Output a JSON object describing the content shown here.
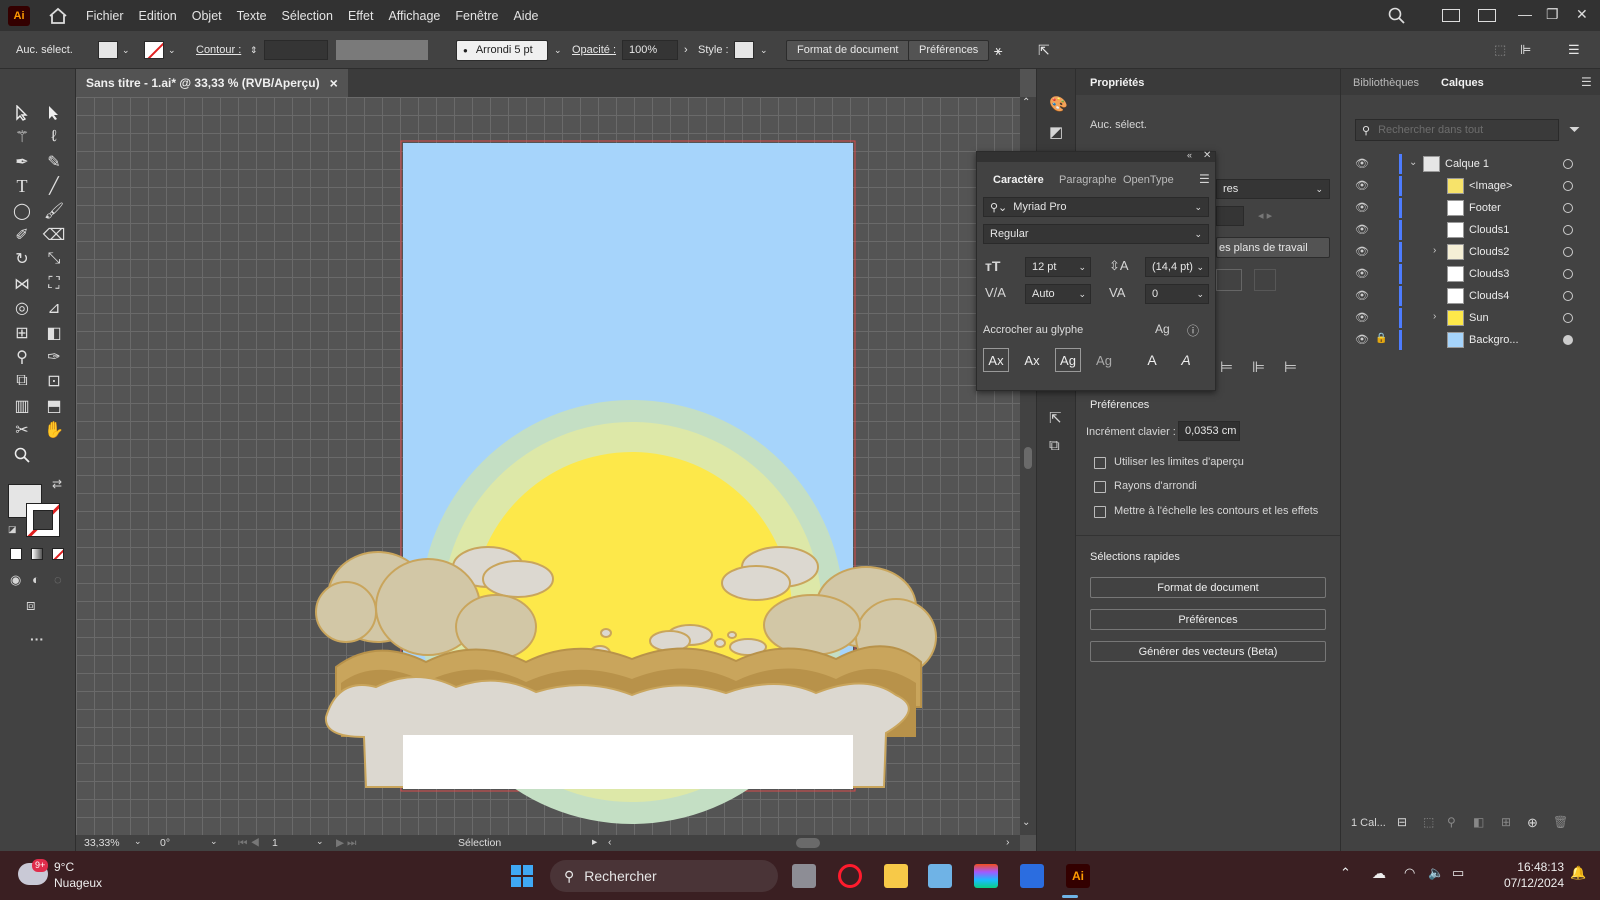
{
  "app": {
    "logo": "Ai"
  },
  "menu": [
    "Fichier",
    "Edition",
    "Objet",
    "Texte",
    "Sélection",
    "Effet",
    "Affichage",
    "Fenêtre",
    "Aide"
  ],
  "control": {
    "selection": "Auc. sélect.",
    "contour_label": "Contour :",
    "brush": "Arrondi 5 pt",
    "opacity_label": "Opacité :",
    "opacity": "100%",
    "style_label": "Style :",
    "doc_format": "Format de document",
    "preferences": "Préférences"
  },
  "document": {
    "tab_title": "Sans titre - 1.ai* @ 33,33 % (RVB/Aperçu)",
    "close": "×"
  },
  "status": {
    "zoom": "33,33%",
    "rotation": "0°",
    "artboard": "1",
    "tool": "Sélection"
  },
  "properties": {
    "tab": "Propriétés",
    "no_selection": "Auc. sélect.",
    "partial_dropdown": "res",
    "partial_artboards": "es plans de travail",
    "prefs_title": "Préférences",
    "key_increment_label": "Incrément clavier :",
    "key_increment": "0,0353 cm",
    "checkboxes": [
      "Utiliser les limites d'aperçu",
      "Rayons d'arrondi",
      "Mettre à l'échelle les contours et les effets"
    ],
    "quick_title": "Sélections rapides",
    "buttons": [
      "Format de document",
      "Préférences",
      "Générer des vecteurs (Beta)"
    ]
  },
  "character": {
    "tabs": [
      "Caractère",
      "Paragraphe",
      "OpenType"
    ],
    "font": "Myriad Pro",
    "style": "Regular",
    "size": "12 pt",
    "leading": "(14,4 pt)",
    "kerning": "Auto",
    "tracking": "0",
    "snap_label": "Accrocher au glyphe"
  },
  "layers": {
    "tabs": [
      "Bibliothèques",
      "Calques"
    ],
    "search_placeholder": "Rechercher dans tout",
    "items": [
      {
        "name": "Calque 1",
        "level": 0,
        "expanded": true
      },
      {
        "name": "<Image>",
        "level": 1
      },
      {
        "name": "Footer",
        "level": 1
      },
      {
        "name": "Clouds1",
        "level": 1
      },
      {
        "name": "Clouds2",
        "level": 1,
        "expandable": true
      },
      {
        "name": "Clouds3",
        "level": 1
      },
      {
        "name": "Clouds4",
        "level": 1
      },
      {
        "name": "Sun",
        "level": 1,
        "expandable": true
      },
      {
        "name": "Backgro...",
        "level": 1,
        "locked": true
      }
    ],
    "footer_count": "1 Cal..."
  },
  "taskbar": {
    "weather_temp": "9°C",
    "weather_desc": "Nuageux",
    "weather_badge": "9+",
    "search": "Rechercher",
    "time": "16:48:13",
    "date": "07/12/2024"
  },
  "colors": {
    "accent": "#4d7cff",
    "sky": "#a6d4fb",
    "sun": "#fde84a",
    "cloud": "#dcd8d0",
    "cloud_outline": "#c9a55c"
  }
}
